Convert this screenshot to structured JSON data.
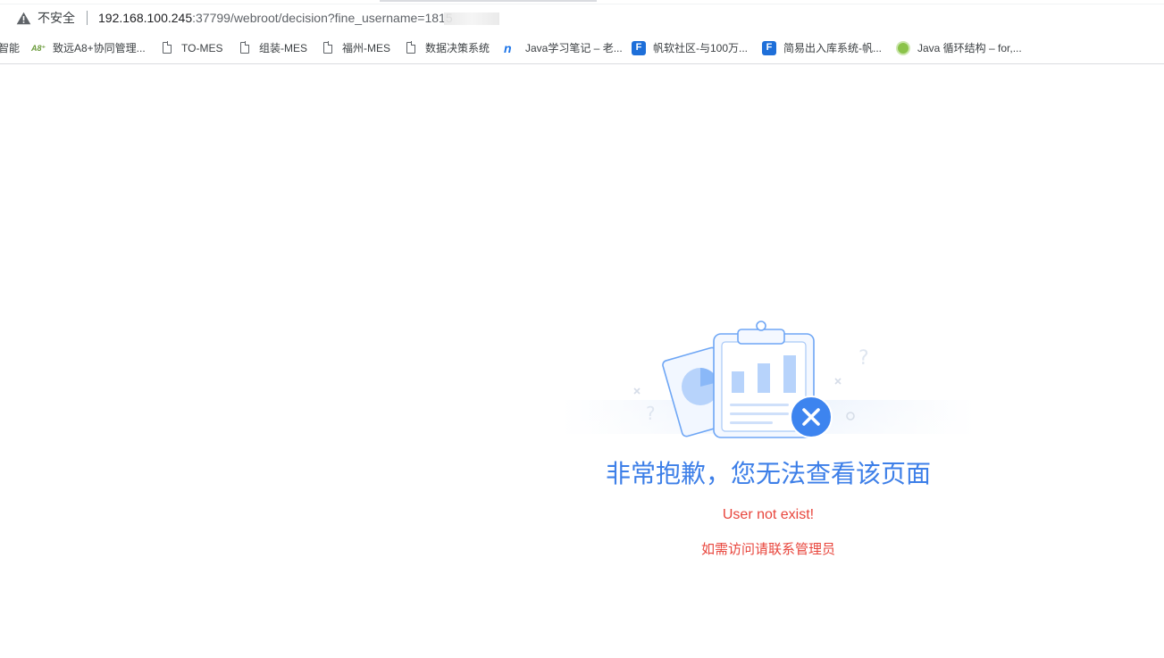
{
  "addressbar": {
    "security_label": "不安全",
    "url_host": "192.168.100.245",
    "url_path": ":37799/webroot/decision?fine_username=1815"
  },
  "bookmarks": [
    {
      "label": "智能",
      "icon": "none"
    },
    {
      "label": "致远A8+协同管理...",
      "icon": "a8-logo-icon"
    },
    {
      "label": "TO-MES",
      "icon": "page-icon"
    },
    {
      "label": "组装-MES",
      "icon": "page-icon"
    },
    {
      "label": "福州-MES",
      "icon": "page-icon"
    },
    {
      "label": "数据决策系统",
      "icon": "page-icon"
    },
    {
      "label": "Java学习笔记 – 老...",
      "icon": "n-logo-icon"
    },
    {
      "label": "帆软社区-与100万...",
      "icon": "fanruan-logo-icon"
    },
    {
      "label": "简易出入库系统-帆...",
      "icon": "fanruan-logo-icon"
    },
    {
      "label": "Java 循环结构 – for,...",
      "icon": "runoob-logo-icon"
    }
  ],
  "error": {
    "title": "非常抱歉，您无法查看该页面",
    "message": "User not exist!",
    "hint": "如需访问请联系管理员"
  },
  "colors": {
    "title_blue": "#3d7fe8",
    "error_red": "#e8453c",
    "illustration_blue": "#6ea6f5"
  }
}
